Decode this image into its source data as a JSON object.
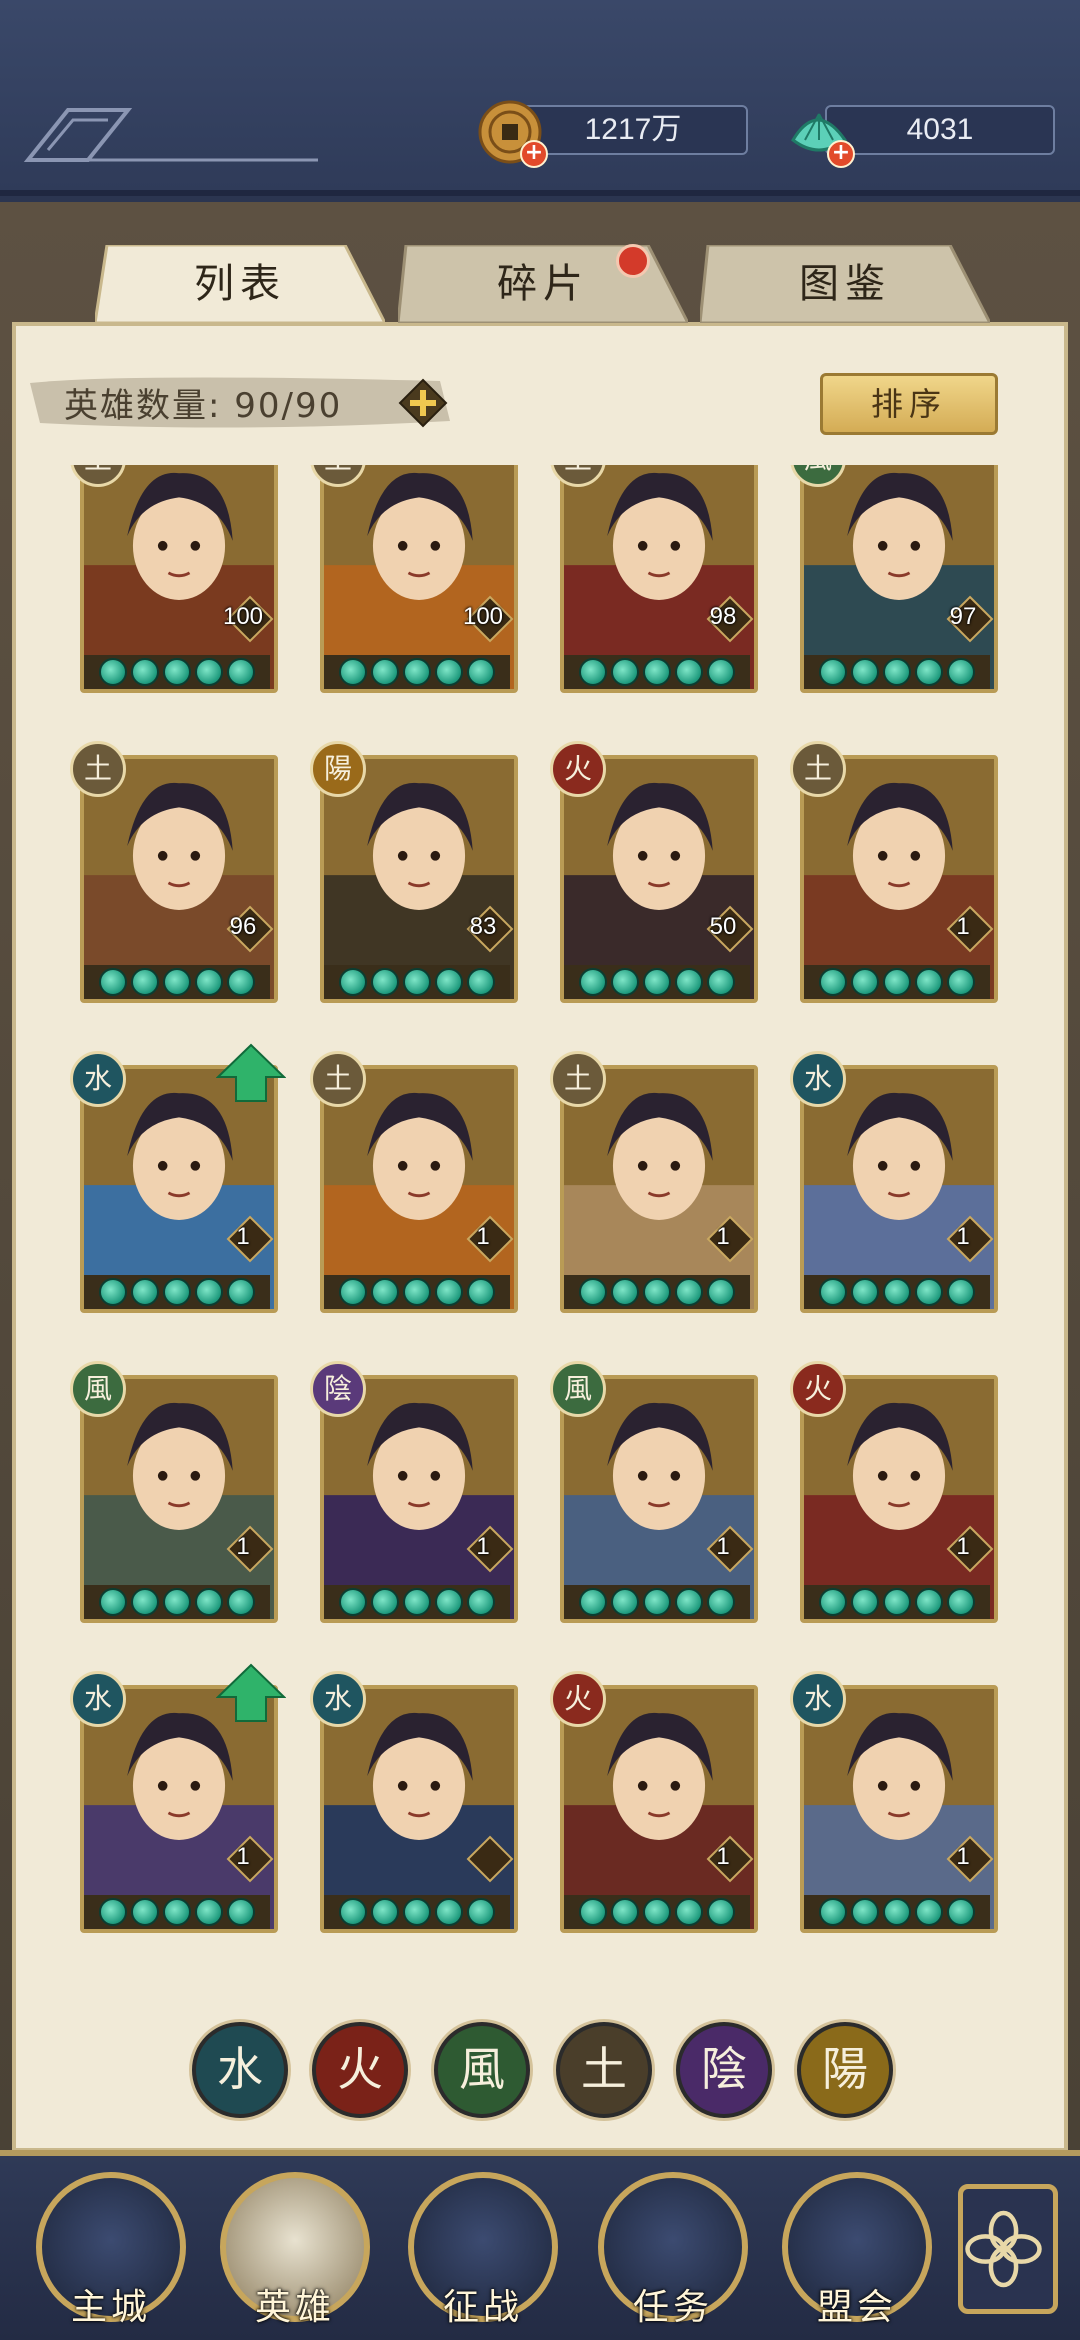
{
  "currency": {
    "coins": {
      "value": "1217万",
      "icon": "copper-coin-icon"
    },
    "jade": {
      "value": "4031",
      "icon": "jade-shell-icon"
    }
  },
  "tabs": [
    {
      "label": "列表",
      "active": true
    },
    {
      "label": "碎片",
      "active": false,
      "has_notification": true
    },
    {
      "label": "图鉴",
      "active": false
    }
  ],
  "hero_count": {
    "label": "英雄数量:",
    "value": "90/90"
  },
  "sort_button": "排序",
  "heroes": [
    {
      "element": "土",
      "element_color": "#6b5a3a",
      "level": "100",
      "bg": "#7a3a1f"
    },
    {
      "element": "土",
      "element_color": "#6b5a3a",
      "level": "100",
      "bg": "#b2651f"
    },
    {
      "element": "土",
      "element_color": "#6b5a3a",
      "level": "98",
      "bg": "#7a2a22"
    },
    {
      "element": "風",
      "element_color": "#3c6b3f",
      "level": "97",
      "bg": "#2e4a52"
    },
    {
      "element": "土",
      "element_color": "#6b5a3a",
      "level": "96",
      "bg": "#7a4a2a"
    },
    {
      "element": "陽",
      "element_color": "#9a6a1a",
      "level": "83",
      "bg": "#403624"
    },
    {
      "element": "火",
      "element_color": "#8a2a1e",
      "level": "50",
      "bg": "#3a2a2a"
    },
    {
      "element": "土",
      "element_color": "#6b5a3a",
      "level": "1",
      "bg": "#7a3a22"
    },
    {
      "element": "水",
      "element_color": "#1f5560",
      "level": "1",
      "bg": "#3c6fa0",
      "upgrade": true
    },
    {
      "element": "土",
      "element_color": "#6b5a3a",
      "level": "1",
      "bg": "#b2651f"
    },
    {
      "element": "土",
      "element_color": "#6b5a3a",
      "level": "1",
      "bg": "#a8875a"
    },
    {
      "element": "水",
      "element_color": "#1f5560",
      "level": "1",
      "bg": "#5c6f9a"
    },
    {
      "element": "風",
      "element_color": "#3c6b3f",
      "level": "1",
      "bg": "#4a5a4a"
    },
    {
      "element": "陰",
      "element_color": "#5a3a7a",
      "level": "1",
      "bg": "#3b2a55"
    },
    {
      "element": "風",
      "element_color": "#3c6b3f",
      "level": "1",
      "bg": "#4a6080"
    },
    {
      "element": "火",
      "element_color": "#8a2a1e",
      "level": "1",
      "bg": "#7a2a22"
    },
    {
      "element": "水",
      "element_color": "#1f5560",
      "level": "1",
      "bg": "#4a3a6a",
      "upgrade": true
    },
    {
      "element": "水",
      "element_color": "#1f5560",
      "level": "",
      "bg": "#2a3a5a"
    },
    {
      "element": "火",
      "element_color": "#8a2a1e",
      "level": "1",
      "bg": "#6a2a22"
    },
    {
      "element": "水",
      "element_color": "#1f5560",
      "level": "1",
      "bg": "#5a6a8a"
    }
  ],
  "element_filters": [
    {
      "glyph": "水",
      "color": "#1f4a52"
    },
    {
      "glyph": "火",
      "color": "#7a2218"
    },
    {
      "glyph": "風",
      "color": "#2e5a32"
    },
    {
      "glyph": "土",
      "color": "#4a3e2a"
    },
    {
      "glyph": "陰",
      "color": "#4a2a68"
    },
    {
      "glyph": "陽",
      "color": "#8a6a1a"
    }
  ],
  "nav": [
    {
      "label": "主城",
      "icon": "city-gate-icon"
    },
    {
      "label": "英雄",
      "icon": "hero-portrait-icon",
      "active": true
    },
    {
      "label": "征战",
      "icon": "campaign-icon"
    },
    {
      "label": "任务",
      "icon": "quest-scroll-icon"
    },
    {
      "label": "盟会",
      "icon": "alliance-icon"
    }
  ],
  "menu_icon": "flower-menu-icon"
}
